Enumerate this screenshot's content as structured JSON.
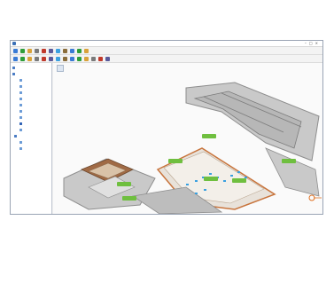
{
  "window": {
    "title": "",
    "controls": "",
    "background": "#f0f0f0"
  },
  "toolbar_row1": {
    "icons": [
      "new-icon",
      "open-icon",
      "save-icon",
      "print-icon",
      "cut-icon",
      "copy-icon",
      "paste-icon",
      "undo-icon",
      "redo-icon",
      "zoom-icon",
      "pan-icon"
    ]
  },
  "toolbar_row2": {
    "icons": [
      "select-icon",
      "move-icon",
      "rotate-icon",
      "layer-icon",
      "measure-icon",
      "grid-icon",
      "view-3d-icon",
      "view-top-icon",
      "light-icon",
      "camera-icon",
      "tag-icon",
      "filter-icon",
      "export-icon",
      "settings-icon"
    ]
  },
  "sidebar": {
    "items": [
      {
        "label": "",
        "color": "#4a7cc4"
      },
      {
        "label": "",
        "color": "#4a7cc4"
      },
      {
        "label": "",
        "color": "#6b9bd6"
      },
      {
        "label": "",
        "color": "#6b9bd6"
      },
      {
        "label": "",
        "color": "#6b9bd6"
      },
      {
        "label": "",
        "color": "#6b9bd6"
      },
      {
        "label": "",
        "color": "#6b9bd6"
      },
      {
        "label": "",
        "color": "#6b9bd6"
      },
      {
        "label": "",
        "color": "#6b9bd6"
      },
      {
        "label": "",
        "color": "#2f62b5"
      },
      {
        "label": "",
        "color": "#6b9bd6"
      },
      {
        "label": "",
        "color": "#4a7cc4"
      },
      {
        "label": "",
        "color": "#6b9bd6"
      },
      {
        "label": "",
        "color": "#6b9bd6"
      }
    ]
  },
  "viewport": {
    "tab_label": "",
    "background": "#fafafa",
    "map_labels": [
      {
        "text": "",
        "color": "#6fbf3f"
      },
      {
        "text": "",
        "color": "#6fbf3f"
      },
      {
        "text": "",
        "color": "#6fbf3f"
      },
      {
        "text": "",
        "color": "#6fbf3f"
      },
      {
        "text": "",
        "color": "#6fbf3f"
      },
      {
        "text": "",
        "color": "#6fbf3f"
      },
      {
        "text": "",
        "color": "#6fbf3f"
      }
    ],
    "colors": {
      "wall": "#8e8e8e",
      "floor": "#c9c9c9",
      "corridor": "#e8e2da",
      "accent": "#c8743c",
      "marker": "#3aa0e0"
    }
  }
}
